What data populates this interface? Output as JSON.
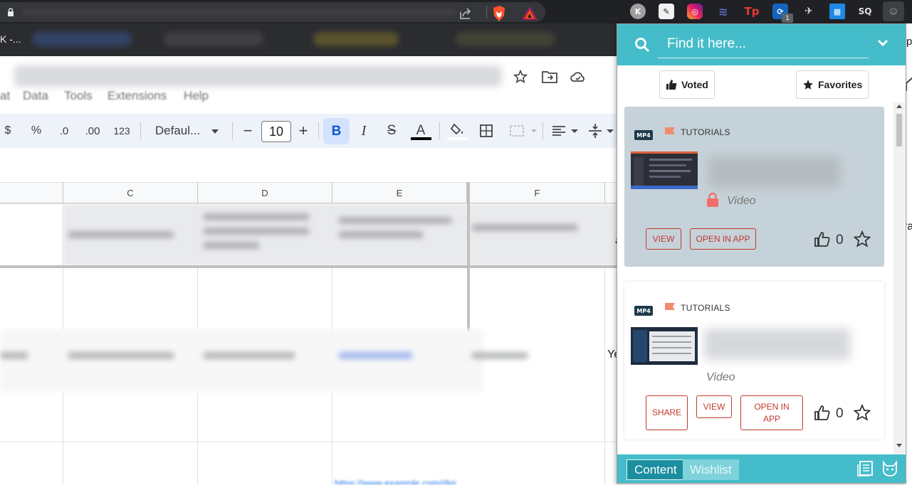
{
  "browser": {
    "tab_label": "K -...",
    "extension_badge_count": "1",
    "extensions": [
      "k-icon",
      "quill-icon",
      "instagram-icon",
      "waves-icon",
      "tp-icon",
      "blue-ext-icon",
      "bird-icon",
      "grid-icon",
      "sq-icon",
      "cat-icon"
    ]
  },
  "sheet": {
    "menu": [
      "at",
      "Data",
      "Tools",
      "Extensions",
      "Help"
    ],
    "toolbar": {
      "currency": "$",
      "percent": "%",
      "dec_decrease": ".0",
      "dec_increase": ".00",
      "number_format": "123",
      "font": "Defaul...",
      "font_size": "10",
      "bold": "B",
      "italic": "I",
      "strike": "S",
      "text_color": "A"
    },
    "columns": [
      "C",
      "D",
      "E",
      "F"
    ],
    "cell_ye": "Ye",
    "cell_a": "a",
    "cell_ra": "ra",
    "edge_text": "p"
  },
  "popup": {
    "search_placeholder": "Find it here...",
    "voted_label": "Voted",
    "favorites_label": "Favorites",
    "cards": [
      {
        "format": "MP4",
        "category": "TUTORIALS",
        "type": "Video",
        "locked": true,
        "buttons": [
          "VIEW",
          "OPEN IN APP"
        ],
        "votes": "0"
      },
      {
        "format": "MP4",
        "category": "TUTORIALS",
        "type": "Video",
        "locked": false,
        "buttons": [
          "SHARE",
          "VIEW",
          "OPEN IN APP"
        ],
        "votes": "0"
      }
    ],
    "footer": {
      "tab_content": "Content",
      "tab_wishlist": "Wishlist"
    },
    "colors": {
      "header": "#45bcc9",
      "active_card": "#c6d2d9",
      "button_accent": "#c0392b",
      "footer_active": "#1b8fa0"
    }
  }
}
